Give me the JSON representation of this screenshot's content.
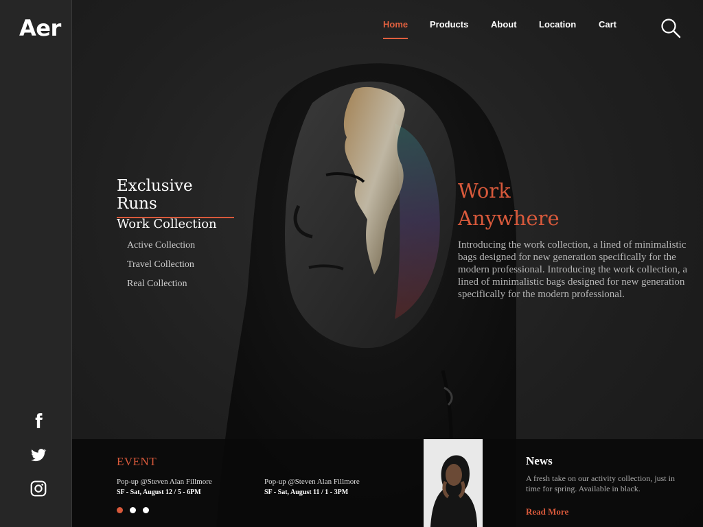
{
  "brand": {
    "logo": "Aer"
  },
  "nav": {
    "items": [
      {
        "label": "Home",
        "active": true
      },
      {
        "label": "Products",
        "active": false
      },
      {
        "label": "About",
        "active": false
      },
      {
        "label": "Location",
        "active": false
      },
      {
        "label": "Cart",
        "active": false
      }
    ],
    "search_icon": "search-icon"
  },
  "social": [
    "facebook-icon",
    "twitter-icon",
    "instagram-icon"
  ],
  "collections": {
    "title": "Exclusive Runs",
    "current": "Work Collection",
    "links": [
      "Active Collection",
      "Travel Collection",
      "Real Collection"
    ]
  },
  "hero": {
    "headline_line1": "Work",
    "headline_line2": "Anywhere",
    "intro": "Introducing the work collection, a lined of minimalistic bags designed for new generation specifically for the modern professional. Introducing the work collection, a lined of minimalistic bags designed for new generation specifically for the modern professional."
  },
  "events": {
    "label": "EVENT",
    "items": [
      {
        "title": "Pop-up @Steven Alan Fillmore",
        "date": "SF - Sat, August 12 / 5 - 6PM"
      },
      {
        "title": "Pop-up @Steven Alan Fillmore",
        "date": "SF - Sat, August 11 / 1 - 3PM"
      }
    ],
    "pagination": {
      "count": 3,
      "active": 1
    }
  },
  "news": {
    "title": "News",
    "text": "A fresh take on our activity collection, just in time for spring. Available in black.",
    "link": "Read More"
  },
  "colors": {
    "accent": "#d8593b",
    "background": "#1f1f1f",
    "sidebar": "#262626"
  }
}
